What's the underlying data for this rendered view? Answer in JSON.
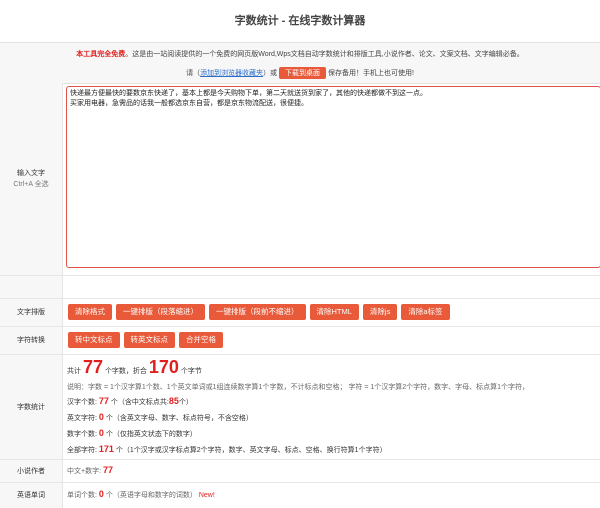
{
  "page": {
    "title": "字数统计 - 在线字数计算器"
  },
  "notice": {
    "free": "本工具完全免费",
    "desc": "。这是由一站阅读提供的一个免费的网页版Word,Wps文档自动字数统计和排版工具,小说作者、论文、文案文档、文字编辑必备。",
    "please": "请（",
    "bookmark_link": "添加到浏览器收藏夹",
    "or": "）或",
    "download_btn": "下载到桌面",
    "tail": "保存备用！手机上也可使用!"
  },
  "input": {
    "label": "输入文字",
    "hint": "Ctrl+A 全选",
    "text": "快递最方便最快的要数京东快递了，基本上都是今天购物下单，第二天就送货到家了，其他的快递都做不到这一点。\n买家用电器，急需品的话我一般都选京东自营，都是京东物流配送，很便捷。"
  },
  "format": {
    "label": "文字排版",
    "buttons": [
      "清除格式",
      "一键排版（段落缩进）",
      "一键排版（段前不缩进）",
      "清除HTML",
      "清除js",
      "清除a标签"
    ]
  },
  "convert": {
    "label": "字符转换",
    "buttons": [
      "转中文标点",
      "转英文标点",
      "合并空格"
    ]
  },
  "stats": {
    "label": "字数统计",
    "total_prefix": "共计",
    "total_words": "77",
    "total_words_unit": "个字数，折合",
    "total_chars": "170",
    "total_chars_unit": "个字节",
    "explain": "说明：字数 = 1个汉字算1个数、1个英文单词或1组连续数字算1个字数，不计标点和空格； 字符 = 1个汉字算2个字符，数字、字母、标点算1个字符，",
    "cn_label": "汉字个数:",
    "cn_value": "77",
    "cn_mid": "个（含中文标点共:",
    "cn_punct": "85",
    "cn_end": "个）",
    "en_label": "英文字符:",
    "en_value": "0",
    "en_note": "个（含英文字母、数字、标点符号，不含空格）",
    "digit_label": "数字个数:",
    "digit_value": "0",
    "digit_note": "个（仅指英文状态下的数字）",
    "all_label": "全部字符:",
    "all_value": "171",
    "all_note": "个（1个汉字或汉字标点算2个字符，数字、英文字母、标点、空格、换行符算1个字符）"
  },
  "novel": {
    "label": "小说作者",
    "prefix": "中文+数字:",
    "value": "77"
  },
  "english": {
    "label": "英语单词",
    "prefix": "单词个数:",
    "value": "0",
    "note": "个（英语字母和数字的词数）",
    "new": "New!"
  }
}
